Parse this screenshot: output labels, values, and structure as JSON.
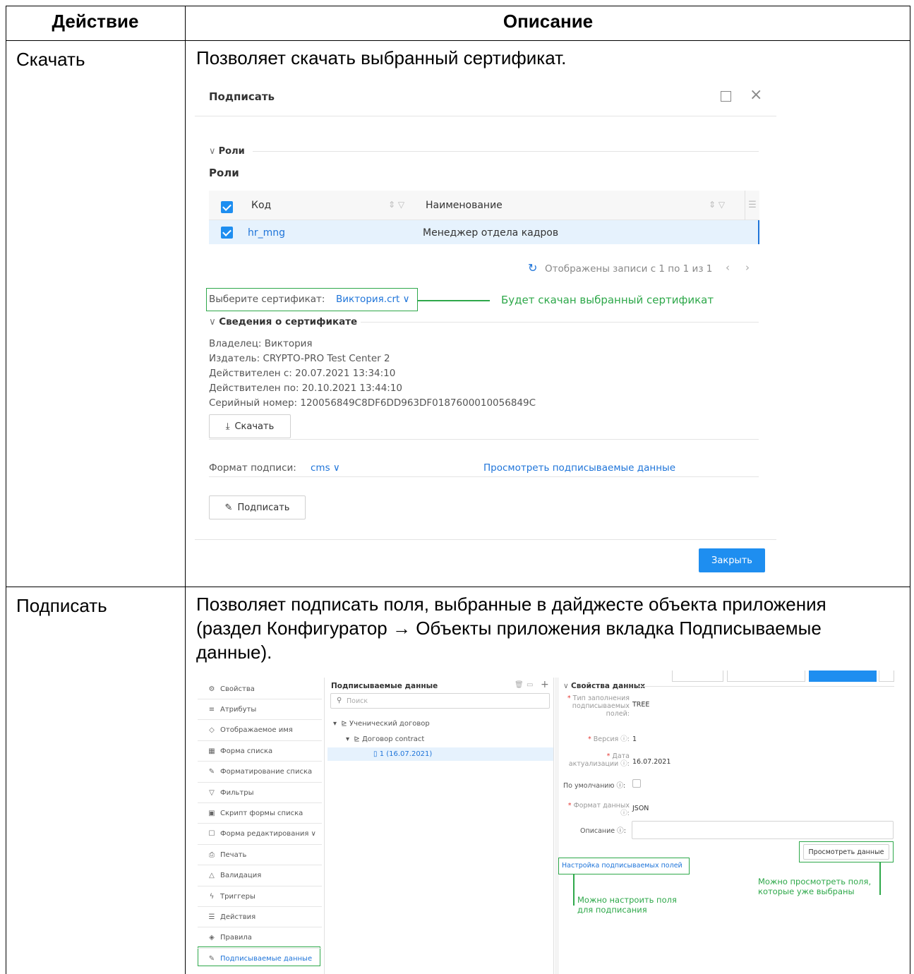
{
  "table": {
    "header_action": "Действие",
    "header_description": "Описание",
    "rows": [
      {
        "action": "Скачать",
        "description": "Позволяет скачать выбранный сертификат."
      },
      {
        "action": "Подписать",
        "description_lines": [
          "Позволяет подписать поля, выбранные в дайджесте объекта приложения",
          "(раздел Конфигуратор → Объекты приложения вкладка Подписываемые",
          "данные)."
        ]
      }
    ]
  },
  "sign_dialog": {
    "title": "Подписать",
    "roles_section": "Роли",
    "roles_heading": "Роли",
    "columns": {
      "code": "Код",
      "name": "Наименование"
    },
    "row": {
      "code": "hr_mng",
      "name": "Менеджер отдела кадров"
    },
    "pagination": "Отображены записи с 1 по 1 из 1",
    "cert_label": "Выберите сертификат:",
    "cert_value": "Виктория.crt",
    "cert_callout": "Будет скачан выбранный сертификат",
    "cert_section": "Сведения о сертификате",
    "cert_details": [
      "Владелец: Виктория",
      "Издатель: CRYPTO-PRO Test Center 2",
      "Действителен с: 20.07.2021 13:34:10",
      "Действителен по: 20.10.2021 13:44:10",
      "Серийный номер: 120056849C8DF6DD963DF0187600010056849C"
    ],
    "download_button": "Скачать",
    "format_label": "Формат подписи:",
    "format_value": "cms",
    "view_link": "Просмотреть подписываемые данные",
    "sign_button": "Подписать",
    "close_button": "Закрыть",
    "accent_color": "#1e8ef0",
    "callout_color": "#2ea84a"
  },
  "configurator": {
    "sidebar": [
      {
        "icon": "gear-icon",
        "glyph": "⚙",
        "label": "Свойства"
      },
      {
        "icon": "list-icon",
        "glyph": "≡",
        "label": "Атрибуты"
      },
      {
        "icon": "tag-icon",
        "glyph": "◇",
        "label": "Отображаемое имя"
      },
      {
        "icon": "grid-icon",
        "glyph": "▦",
        "label": "Форма списка"
      },
      {
        "icon": "brush-icon",
        "glyph": "✎",
        "label": "Форматирование списка"
      },
      {
        "icon": "filter-icon",
        "glyph": "▽",
        "label": "Фильтры"
      },
      {
        "icon": "script-icon",
        "glyph": "▣",
        "label": "Скрипт формы списка"
      },
      {
        "icon": "edit-form-icon",
        "glyph": "☐",
        "label": "Форма редактирования ∨"
      },
      {
        "icon": "print-icon",
        "glyph": "⎙",
        "label": "Печать"
      },
      {
        "icon": "warning-icon",
        "glyph": "△",
        "label": "Валидация"
      },
      {
        "icon": "trigger-icon",
        "glyph": "ϟ",
        "label": "Триггеры"
      },
      {
        "icon": "actions-icon",
        "glyph": "☰",
        "label": "Действия"
      },
      {
        "icon": "rules-icon",
        "glyph": "◈",
        "label": "Правила"
      },
      {
        "icon": "pen-icon",
        "glyph": "✎",
        "label": "Подписываемые данные"
      }
    ],
    "tree_title": "Подписываемые данные",
    "search_placeholder": "Поиск",
    "tree": [
      "Ученический договор",
      "Договор contract",
      "1 (16.07.2021)"
    ],
    "props_section": "Свойства данных",
    "props": {
      "fill_type_label_1": "Тип заполнения",
      "fill_type_label_2": "подписываемых",
      "fill_type_label_3": "полей:",
      "fill_type_value": "TREE",
      "version_label": "Версия",
      "version_value": "1",
      "date_label_1": "Дата",
      "date_label_2": "актуализации",
      "date_value": "16.07.2021",
      "default_label": "По умолчанию",
      "format_label_1": "Формат данных",
      "format_value": "JSON",
      "description_label": "Описание"
    },
    "view_data_button": "Просмотреть данные",
    "setup_link": "Настройка подписываемых полей",
    "callout_left_1": "Можно настроить поля",
    "callout_left_2": "для подписания",
    "callout_right_1": "Можно просмотреть поля,",
    "callout_right_2": "которые уже выбраны"
  }
}
